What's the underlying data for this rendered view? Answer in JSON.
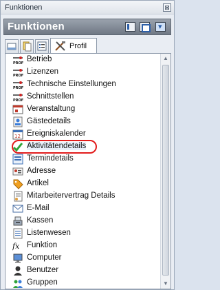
{
  "window": {
    "title": "Funktionen",
    "close_glyph": "⊠"
  },
  "header": {
    "title": "Funktionen"
  },
  "tabs": {
    "active_label": "Profil"
  },
  "items": [
    {
      "label": "Betrieb",
      "icon": "profil-icon"
    },
    {
      "label": "Lizenzen",
      "icon": "profil-icon"
    },
    {
      "label": "Technische Einstellungen",
      "icon": "profil-icon"
    },
    {
      "label": "Schnittstellen",
      "icon": "profil-icon"
    },
    {
      "label": "Veranstaltung",
      "icon": "event-icon"
    },
    {
      "label": "Gästedetails",
      "icon": "guest-icon"
    },
    {
      "label": "Ereigniskalender",
      "icon": "calendar-icon"
    },
    {
      "label": "Aktivitätendetails",
      "icon": "checkmark-icon"
    },
    {
      "label": "Termindetails",
      "icon": "appointment-icon"
    },
    {
      "label": "Adresse",
      "icon": "address-card-icon"
    },
    {
      "label": "Artikel",
      "icon": "tag-icon"
    },
    {
      "label": "Mitarbeitervertrag Details",
      "icon": "contract-icon"
    },
    {
      "label": "E-Mail",
      "icon": "email-icon"
    },
    {
      "label": "Kassen",
      "icon": "cash-register-icon"
    },
    {
      "label": "Listenwesen",
      "icon": "list-icon"
    },
    {
      "label": "Funktion",
      "icon": "function-icon"
    },
    {
      "label": "Computer",
      "icon": "computer-icon"
    },
    {
      "label": "Benutzer",
      "icon": "user-icon"
    },
    {
      "label": "Gruppen",
      "icon": "group-icon"
    }
  ],
  "colors": {
    "highlight": "#e21b1b",
    "header_bg": "#7d8692"
  }
}
